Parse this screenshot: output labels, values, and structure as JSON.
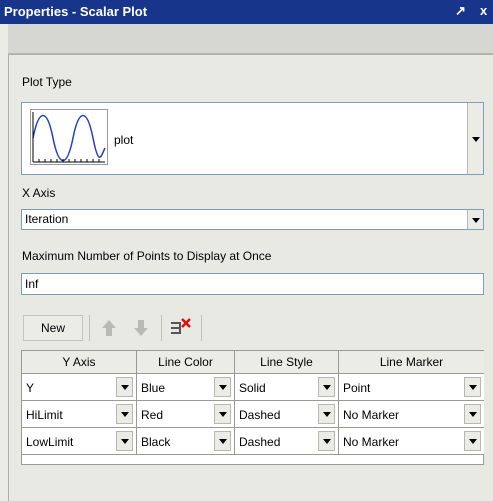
{
  "window": {
    "title": "Properties - Scalar Plot",
    "pin_glyph": "↗",
    "close_glyph": "x"
  },
  "plot_type": {
    "label": "Plot Type",
    "selected": "plot",
    "icon": "sine-wave-plot-icon"
  },
  "x_axis": {
    "label": "X Axis",
    "selected": "Iteration"
  },
  "max_points": {
    "label": "Maximum Number of Points to Display at Once",
    "value": "Inf"
  },
  "toolbar": {
    "new_label": "New",
    "move_up_icon": "arrow-up-icon",
    "move_down_icon": "arrow-down-icon",
    "delete_icon": "delete-column-icon"
  },
  "table": {
    "headers": [
      "Y Axis",
      "Line Color",
      "Line Style",
      "Line Marker"
    ],
    "rows": [
      [
        "Y",
        "Blue",
        "Solid",
        "Point"
      ],
      [
        "HiLimit",
        "Red",
        "Dashed",
        "No Marker"
      ],
      [
        "LowLimit",
        "Black",
        "Dashed",
        "No Marker"
      ]
    ]
  },
  "colors": {
    "titlebar": "#17368b",
    "panel": "#e9e9e4",
    "plot_line": "#1f3fbf"
  }
}
